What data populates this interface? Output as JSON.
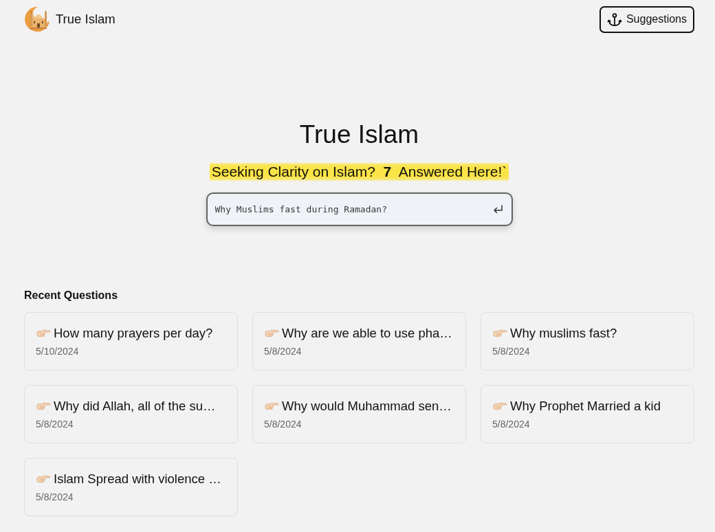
{
  "header": {
    "logo_text": "True Islam",
    "suggestions_button": "Suggestions"
  },
  "hero": {
    "title": "True Islam",
    "tagline": "Seeking Clarity on Islam?  **7**  Answered Here!`",
    "search": {
      "placeholder": "Why Muslims fast during Ramadan?"
    }
  },
  "recent": {
    "heading": "Recent Questions",
    "questions": [
      {
        "title": "How many prayers per day?",
        "date": "5/10/2024"
      },
      {
        "title": "Why are we able to use pha…",
        "date": "5/8/2024"
      },
      {
        "title": "Why muslims fast?",
        "date": "5/8/2024"
      },
      {
        "title": "Why did Allah, all of the su…",
        "date": "5/8/2024"
      },
      {
        "title": "Why would Muhammad sen…",
        "date": "5/8/2024"
      },
      {
        "title": "Why Prophet Married a kid",
        "date": "5/8/2024"
      },
      {
        "title": "Islam Spread with violence …",
        "date": "5/8/2024"
      }
    ]
  }
}
